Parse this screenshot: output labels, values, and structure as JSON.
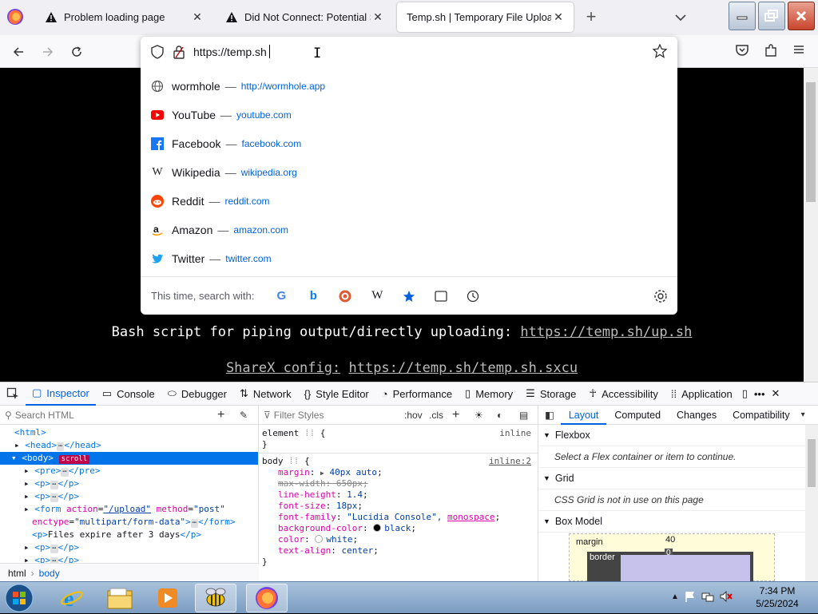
{
  "tabs": [
    {
      "title": "Problem loading page",
      "icon": "warning-icon"
    },
    {
      "title": "Did Not Connect: Potential Security Issue",
      "icon": "warning-icon"
    },
    {
      "title": "Temp.sh | Temporary File Upload",
      "icon": ""
    }
  ],
  "urlbar": {
    "value": "https://temp.sh",
    "suggestions": [
      {
        "name": "wormhole",
        "url": "http://wormhole.app",
        "icon": "globe-icon"
      },
      {
        "name": "YouTube",
        "url": "youtube.com",
        "icon": "youtube-icon"
      },
      {
        "name": "Facebook",
        "url": "facebook.com",
        "icon": "facebook-icon"
      },
      {
        "name": "Wikipedia",
        "url": "wikipedia.org",
        "icon": "wikipedia-icon"
      },
      {
        "name": "Reddit",
        "url": "reddit.com",
        "icon": "reddit-icon"
      },
      {
        "name": "Amazon",
        "url": "amazon.com",
        "icon": "amazon-icon"
      },
      {
        "name": "Twitter",
        "url": "twitter.com",
        "icon": "twitter-icon"
      }
    ],
    "search_with_label": "This time, search with:",
    "separator": "—"
  },
  "page": {
    "line1_text": "Bash script for piping output/directly uploading:",
    "line1_link": "https://temp.sh/up.sh",
    "line2_label": "ShareX config:",
    "line2_link": "https://temp.sh/temp.sh.sxcu"
  },
  "devtools": {
    "tabs": [
      "Inspector",
      "Console",
      "Debugger",
      "Network",
      "Style Editor",
      "Performance",
      "Memory",
      "Storage",
      "Accessibility",
      "Application"
    ],
    "active_tab": "Inspector",
    "search_placeholder": "Search HTML",
    "filter_placeholder": "Filter Styles",
    "hov_label": ":hov",
    "cls_label": ".cls",
    "breadcrumbs": [
      "html",
      "body"
    ],
    "layout_tabs": [
      "Layout",
      "Computed",
      "Changes",
      "Compatibility"
    ],
    "flexbox_title": "Flexbox",
    "flexbox_note": "Select a Flex container or item to continue.",
    "grid_title": "Grid",
    "grid_note": "CSS Grid is not in use on this page",
    "boxmodel_title": "Box Model",
    "boxmodel_margin_label": "margin",
    "boxmodel_margin_value": "40",
    "boxmodel_border_label": "border",
    "boxmodel_border_value": "0",
    "tree": {
      "html": "<html>",
      "head_open": "<head>",
      "head_close": "</head>",
      "body_open": "<body>",
      "scroll_badge": "scroll",
      "pre_open": "<pre>",
      "pre_close": "</pre>",
      "p_open": "<p>",
      "p_close": "</p>",
      "form_open": "<form",
      "form_action_attr": "action",
      "form_action_val": "\"/upload\"",
      "form_method_attr": "method",
      "form_method_val": "\"post\"",
      "form_enctype_attr": "enctype",
      "form_enctype_val": "\"multipart/form-data\"",
      "form_close": "</form>",
      "p_files_text": "Files expire after 3 days",
      "ellipsis": "⋯"
    },
    "rules": {
      "element_selector": "element",
      "element_source": "inline",
      "body_selector": "body",
      "body_source": "inline:2",
      "props": [
        {
          "name": "margin",
          "value": "40px auto",
          "strike": false,
          "arrow": true
        },
        {
          "name": "max-width",
          "value": "650px",
          "strike": true
        },
        {
          "name": "line-height",
          "value": "1.4",
          "strike": false
        },
        {
          "name": "font-size",
          "value": "18px",
          "strike": false
        },
        {
          "name": "font-family",
          "value": "\"Lucidia Console\",",
          "value2": "monospace",
          "strike": false
        },
        {
          "name": "background-color",
          "value": "black",
          "swatch": "#000000",
          "strike": false
        },
        {
          "name": "color",
          "value": "white",
          "swatch": "#ffffff",
          "strike": false
        },
        {
          "name": "text-align",
          "value": "center",
          "strike": false
        }
      ]
    }
  },
  "taskbar": {
    "time": "7:34 PM",
    "date": "5/25/2024"
  },
  "colors": {
    "accent": "#0061e0",
    "page_bg": "#000000",
    "link_gray": "#bbbbbb"
  }
}
